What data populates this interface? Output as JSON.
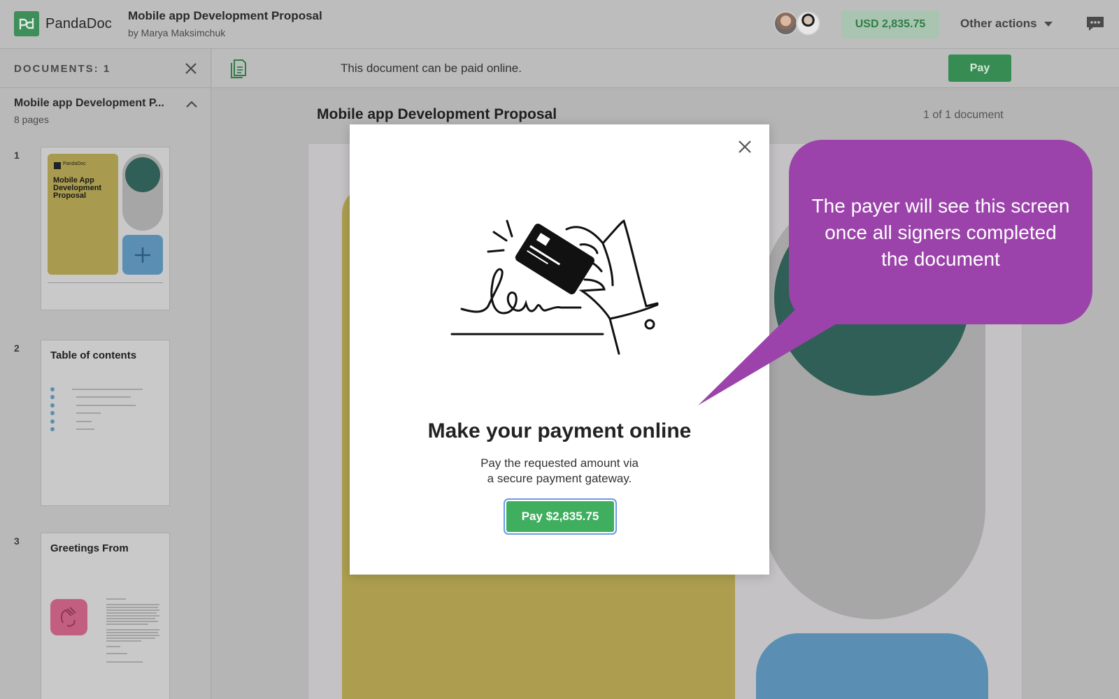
{
  "header": {
    "logo_text": "PandaDoc",
    "doc_title": "Mobile app Development Proposal",
    "doc_author": "by Marya Maksimchuk",
    "price": "USD 2,835.75",
    "other_actions": "Other actions"
  },
  "sidebar": {
    "documents_count": "DOCUMENTS: 1",
    "doc_name": "Mobile app Development P...",
    "pages": "8 pages",
    "thumbnails": [
      {
        "number": "1",
        "logo": "PandaDoc",
        "title": "Mobile App Development Proposal"
      },
      {
        "number": "2",
        "title": "Table of contents"
      },
      {
        "number": "3",
        "title": "Greetings From"
      }
    ]
  },
  "notice": {
    "text": "This document can be paid online.",
    "pay_label": "Pay"
  },
  "main": {
    "title": "Mobile app Development Proposal",
    "doc_count": "1 of 1 document"
  },
  "modal": {
    "title": "Make your payment online",
    "subtitle_line1": "Pay the requested amount via",
    "subtitle_line2": "a secure payment gateway.",
    "pay_button": "Pay $2,835.75"
  },
  "callout": {
    "line1": "The payer will see this screen",
    "line2": "once all signers completed",
    "line3": "the document"
  },
  "colors": {
    "brand_green": "#3fae5f",
    "callout_purple": "#9b43ab",
    "overlay_gray": "#b5b5b5"
  },
  "icons": [
    "pandadoc-logo-icon",
    "avatar",
    "chevron-down-icon",
    "chat-icon",
    "close-icon",
    "chevron-up-icon",
    "document-icon",
    "payment-card-illustration"
  ]
}
